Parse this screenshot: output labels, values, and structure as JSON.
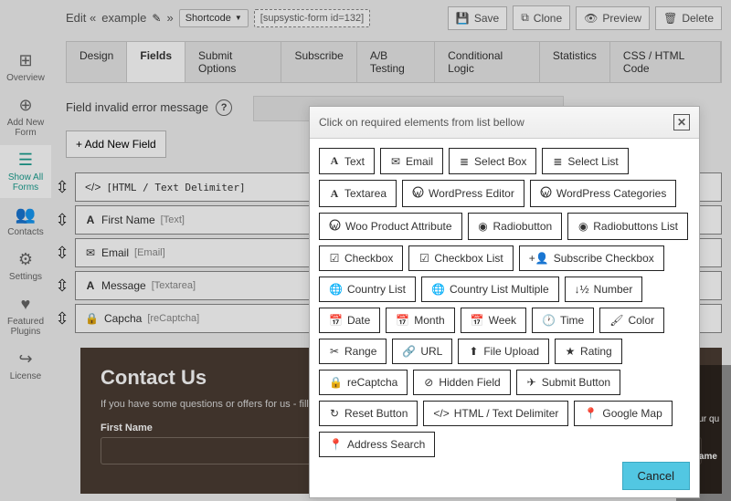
{
  "topbar": {
    "edit_prefix": "Edit «",
    "name": "example",
    "suffix": "»",
    "selector_label": "Shortcode",
    "shortcode": "[supsystic-form id=132]",
    "save": "Save",
    "clone": "Clone",
    "preview": "Preview",
    "delete": "Delete"
  },
  "sidebar": {
    "items": [
      {
        "label": "Overview"
      },
      {
        "label": "Add New Form"
      },
      {
        "label": "Show All Forms"
      },
      {
        "label": "Contacts"
      },
      {
        "label": "Settings"
      },
      {
        "label": "Featured Plugins"
      },
      {
        "label": "License"
      }
    ]
  },
  "tabs": [
    "Design",
    "Fields",
    "Submit Options",
    "Subscribe",
    "A/B Testing",
    "Conditional Logic",
    "Statistics",
    "CSS / HTML Code"
  ],
  "active_tab": "Fields",
  "field_options": {
    "error_label": "Field invalid error message",
    "add_button": "+ Add New Field"
  },
  "fields": [
    {
      "name": "[HTML / Text Delimiter]",
      "type": "",
      "icon": "code"
    },
    {
      "name": "First Name",
      "type": "[Text]",
      "icon": "A"
    },
    {
      "name": "Email",
      "type": "[Email]",
      "icon": "mail"
    },
    {
      "name": "Message",
      "type": "[Textarea]",
      "icon": "A"
    },
    {
      "name": "Capcha",
      "type": "[reCaptcha]",
      "icon": "lock"
    }
  ],
  "preview": {
    "title": "Contact Us",
    "desc": "If you have some questions or offers for us - fill th",
    "field_label": "First Name"
  },
  "right_panel": {
    "line1": "y your qu",
    "line2": "st Name"
  },
  "modal": {
    "title": "Click on required elements from list bellow",
    "cancel": "Cancel",
    "items": [
      {
        "icon": "A",
        "label": "Text"
      },
      {
        "icon": "mail",
        "label": "Email"
      },
      {
        "icon": "list",
        "label": "Select Box"
      },
      {
        "icon": "list",
        "label": "Select List"
      },
      {
        "icon": "A",
        "label": "Textarea"
      },
      {
        "icon": "wp",
        "label": "WordPress Editor"
      },
      {
        "icon": "wp",
        "label": "WordPress Categories"
      },
      {
        "icon": "wp",
        "label": "Woo Product Attribute"
      },
      {
        "icon": "dot",
        "label": "Radiobutton"
      },
      {
        "icon": "dot",
        "label": "Radiobuttons List"
      },
      {
        "icon": "check",
        "label": "Checkbox"
      },
      {
        "icon": "check",
        "label": "Checkbox List"
      },
      {
        "icon": "user",
        "label": "Subscribe Checkbox"
      },
      {
        "icon": "globe",
        "label": "Country List"
      },
      {
        "icon": "globe",
        "label": "Country List Multiple"
      },
      {
        "icon": "num",
        "label": "Number"
      },
      {
        "icon": "cal",
        "label": "Date"
      },
      {
        "icon": "cal",
        "label": "Month"
      },
      {
        "icon": "cal",
        "label": "Week"
      },
      {
        "icon": "clock",
        "label": "Time"
      },
      {
        "icon": "brush",
        "label": "Color"
      },
      {
        "icon": "range",
        "label": "Range"
      },
      {
        "icon": "link",
        "label": "URL"
      },
      {
        "icon": "upload",
        "label": "File Upload"
      },
      {
        "icon": "star",
        "label": "Rating"
      },
      {
        "icon": "lock",
        "label": "reCaptcha"
      },
      {
        "icon": "eyeoff",
        "label": "Hidden Field"
      },
      {
        "icon": "send",
        "label": "Submit Button"
      },
      {
        "icon": "refresh",
        "label": "Reset Button"
      },
      {
        "icon": "code",
        "label": "HTML / Text Delimiter"
      },
      {
        "icon": "pin",
        "label": "Google Map"
      },
      {
        "icon": "pin",
        "label": "Address Search"
      }
    ]
  }
}
